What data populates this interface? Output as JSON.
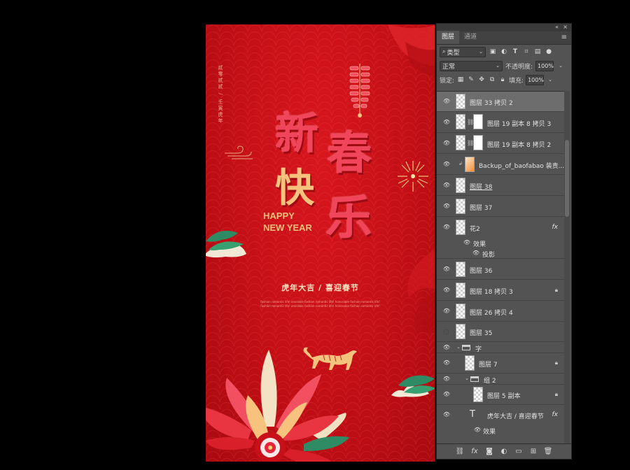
{
  "poster": {
    "vertical_text": "贰零贰贰 / 壬寅虎年",
    "title_chars": [
      "新",
      "春",
      "快",
      "乐"
    ],
    "happy": "HAPPY",
    "new_year": "NEW YEAR",
    "slogan": "虎年大吉 / 喜迎春节",
    "fine_line_1": "fashion romantic life! onorable fashion romantic life! honorable fashion romantic life!",
    "fine_line_2": "fashion romantic life! onorable fashion romantic life! honorable fashion romantic life!",
    "colors": {
      "background": "#c30f16",
      "title": "#f0455a",
      "gold": "#f2c27c",
      "green": "#2e8b63"
    }
  },
  "panel": {
    "window_controls": {
      "collapse": "«",
      "close": "×"
    },
    "tabs": [
      {
        "label": "图层",
        "active": true
      },
      {
        "label": "通道",
        "active": false
      }
    ],
    "menu_icon": "≡",
    "filter": {
      "value": "类型",
      "icon": "search-icon"
    },
    "filter_icons": [
      "image-filter-icon",
      "adjustment-filter-icon",
      "type-filter-icon",
      "shape-filter-icon",
      "smart-object-filter-icon",
      "filter-toggle-icon"
    ],
    "blend_mode": "正常",
    "opacity_label": "不透明度:",
    "opacity_value": "100%",
    "lock_label": "锁定:",
    "fill_label": "填充:",
    "fill_value": "100%",
    "layers": [
      {
        "name": "图层 33 拷贝 2",
        "selected": true
      },
      {
        "name": "图层 19 副本 8 拷贝 3"
      },
      {
        "name": "图层 19 副本 8 拷贝 2"
      },
      {
        "name": "Backup_of_baofabao 装责..."
      },
      {
        "name": "图层 38"
      },
      {
        "name": "图层 37"
      },
      {
        "name": "花2",
        "fx": "fx"
      },
      {
        "name": "效果"
      },
      {
        "name": "投影"
      },
      {
        "name": "图层 36"
      },
      {
        "name": "图层 18 拷贝 3"
      },
      {
        "name": "图层 26 拷贝 4"
      },
      {
        "name": "图层 35"
      },
      {
        "name": "字"
      },
      {
        "name": "图层 7"
      },
      {
        "name": "组 2"
      },
      {
        "name": "图层 5 副本"
      },
      {
        "name": "虎年大吉 / 喜迎春节",
        "fx": "fx",
        "type_icon": "T"
      },
      {
        "name": "效果"
      }
    ]
  }
}
